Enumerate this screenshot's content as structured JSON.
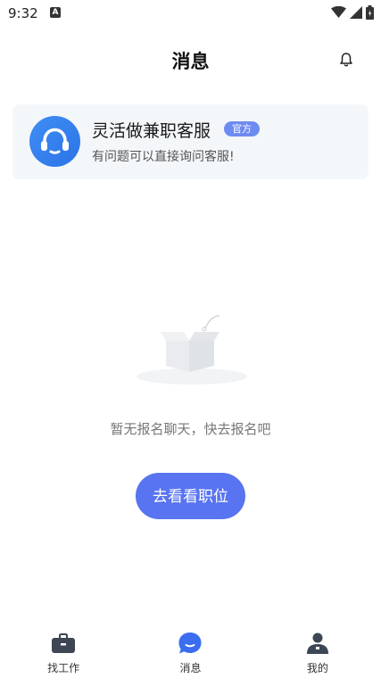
{
  "status_bar": {
    "time": "9:32",
    "notification_badge": "A"
  },
  "header": {
    "title": "消息"
  },
  "service_card": {
    "name": "灵活做兼职客服",
    "badge": "官方",
    "description": "有问题可以直接询问客服!"
  },
  "empty_state": {
    "message": "暂无报名聊天，快去报名吧",
    "button_label": "去看看职位"
  },
  "tabbar": {
    "items": [
      {
        "label": "找工作",
        "icon": "briefcase-icon"
      },
      {
        "label": "消息",
        "icon": "chat-bubble-icon",
        "active": true
      },
      {
        "label": "我的",
        "icon": "person-icon"
      }
    ]
  },
  "colors": {
    "accent": "#5874f0",
    "badge": "#6e8bf2",
    "card_bg": "#f4f7fa",
    "avatar": "#3a86f0"
  }
}
